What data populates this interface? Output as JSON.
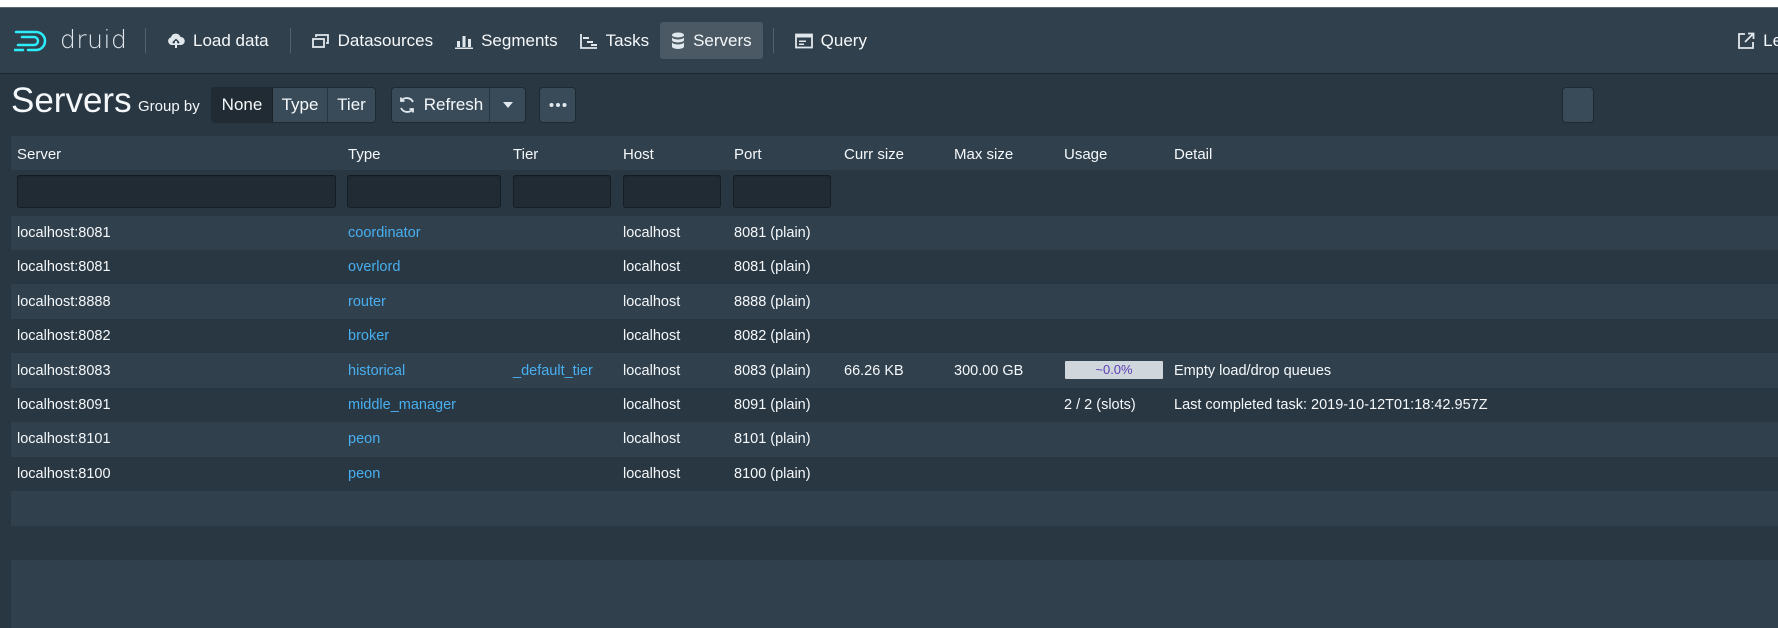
{
  "navbar": {
    "brand": "druid",
    "items": [
      {
        "label": "Load data",
        "icon": "cloud-upload-icon"
      },
      {
        "label": "Datasources",
        "icon": "multi-select-icon"
      },
      {
        "label": "Segments",
        "icon": "stacked-chart-icon"
      },
      {
        "label": "Tasks",
        "icon": "gantt-chart-icon"
      },
      {
        "label": "Servers",
        "icon": "database-icon",
        "active": true
      },
      {
        "label": "Query",
        "icon": "application-icon"
      }
    ],
    "right_label": "Legacy"
  },
  "page": {
    "title": "Servers",
    "group_by_label": "Group by",
    "group_by_options": [
      "None",
      "Type",
      "Tier"
    ],
    "group_by_selected": "None",
    "refresh_label": "Refresh"
  },
  "table": {
    "columns": [
      "Server",
      "Type",
      "Tier",
      "Host",
      "Port",
      "Curr size",
      "Max size",
      "Usage",
      "Detail"
    ],
    "rows": [
      {
        "server": "localhost:8081",
        "type": "coordinator",
        "tier": "",
        "host": "localhost",
        "port": "8081 (plain)",
        "curr_size": "",
        "max_size": "",
        "usage": "",
        "detail": ""
      },
      {
        "server": "localhost:8081",
        "type": "overlord",
        "tier": "",
        "host": "localhost",
        "port": "8081 (plain)",
        "curr_size": "",
        "max_size": "",
        "usage": "",
        "detail": ""
      },
      {
        "server": "localhost:8888",
        "type": "router",
        "tier": "",
        "host": "localhost",
        "port": "8888 (plain)",
        "curr_size": "",
        "max_size": "",
        "usage": "",
        "detail": ""
      },
      {
        "server": "localhost:8082",
        "type": "broker",
        "tier": "",
        "host": "localhost",
        "port": "8082 (plain)",
        "curr_size": "",
        "max_size": "",
        "usage": "",
        "detail": ""
      },
      {
        "server": "localhost:8083",
        "type": "historical",
        "tier": "_default_tier",
        "host": "localhost",
        "port": "8083 (plain)",
        "curr_size": "66.26 KB",
        "max_size": "300.00 GB",
        "usage": "~0.0%",
        "detail": "Empty load/drop queues"
      },
      {
        "server": "localhost:8091",
        "type": "middle_manager",
        "tier": "",
        "host": "localhost",
        "port": "8091 (plain)",
        "curr_size": "",
        "max_size": "",
        "usage": "2 / 2 (slots)",
        "detail": "Last completed task: 2019-10-12T01:18:42.957Z"
      },
      {
        "server": "localhost:8101",
        "type": "peon",
        "tier": "",
        "host": "localhost",
        "port": "8101 (plain)",
        "curr_size": "",
        "max_size": "",
        "usage": "",
        "detail": ""
      },
      {
        "server": "localhost:8100",
        "type": "peon",
        "tier": "",
        "host": "localhost",
        "port": "8100 (plain)",
        "curr_size": "",
        "max_size": "",
        "usage": "",
        "detail": ""
      }
    ]
  },
  "colors": {
    "background": "#293742",
    "navbar": "#30404d",
    "link": "#48aff0",
    "active_nav": "#4a5963"
  }
}
